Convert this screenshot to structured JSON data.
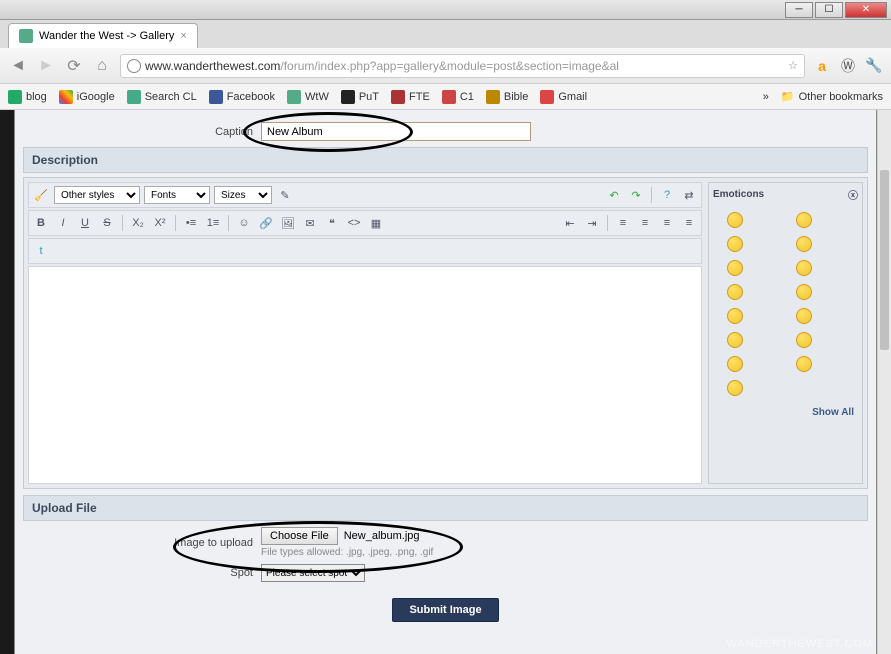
{
  "window": {
    "title": "Wander the West -> Gallery"
  },
  "address": {
    "host": "www.wanderthewest.com",
    "path": "/forum/index.php?app=gallery&module=post&section=image&al"
  },
  "bookmarks": {
    "items": [
      {
        "label": "blog",
        "color": "#2a6"
      },
      {
        "label": "iGoogle",
        "color": "#d44"
      },
      {
        "label": "Search CL",
        "color": "#4a8"
      },
      {
        "label": "Facebook",
        "color": "#3b5998"
      },
      {
        "label": "WtW",
        "color": "#5a8"
      },
      {
        "label": "PuT",
        "color": "#222"
      },
      {
        "label": "FTE",
        "color": "#a33"
      },
      {
        "label": "C1",
        "color": "#c44"
      },
      {
        "label": "Bible",
        "color": "#b80"
      },
      {
        "label": "Gmail",
        "color": "#d44"
      }
    ],
    "more": "»",
    "other": "Other bookmarks"
  },
  "form": {
    "caption_label": "Caption",
    "caption_value": "New Album",
    "description_head": "Description",
    "styles_sel": "Other styles",
    "fonts_sel": "Fonts",
    "sizes_sel": "Sizes",
    "emoticons_head": "Emoticons",
    "show_all": "Show All",
    "upload_head": "Upload File",
    "image_label": "Image to upload",
    "choose_file": "Choose File",
    "chosen_name": "New_album.jpg",
    "filetypes": "File types allowed: .jpg, .jpeg, .png, .gif",
    "spot_label": "Spot",
    "spot_value": "Please select spot",
    "submit": "Submit Image"
  },
  "watermark": "WANDERTHEWEST.COM"
}
